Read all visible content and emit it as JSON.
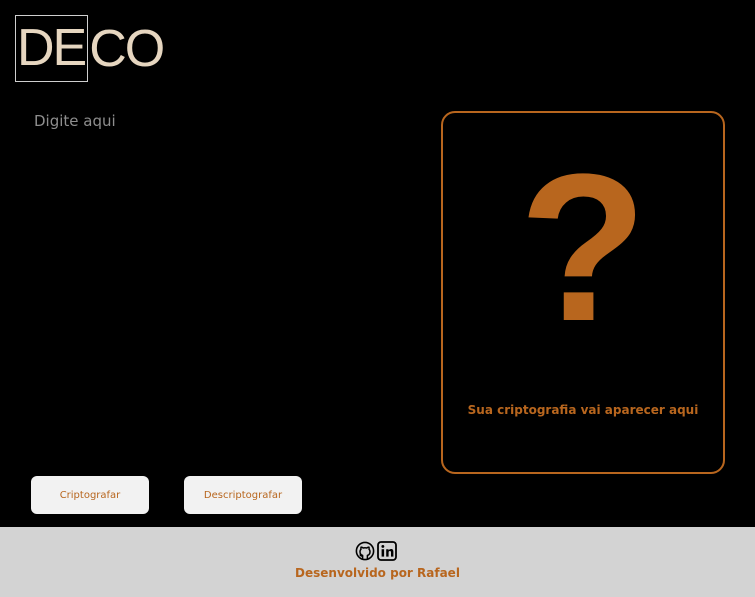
{
  "header": {
    "logo_boxed": "DE",
    "logo_rest": "CO"
  },
  "input": {
    "placeholder": "Digite aqui"
  },
  "output": {
    "icon": "question-mark-icon",
    "symbol": "?",
    "message": "Sua criptografia vai aparecer aqui"
  },
  "buttons": {
    "encrypt_label": "Criptografar",
    "decrypt_label": "Descriptografar"
  },
  "footer": {
    "icons": [
      "github-icon",
      "linkedin-icon"
    ],
    "credit": "Desenvolvido por Rafael"
  },
  "colors": {
    "background": "#000000",
    "accent": "#b8661e",
    "logo": "#e6d6c0",
    "button_bg": "#f2f2f2",
    "footer_bg": "#d3d3d3"
  }
}
